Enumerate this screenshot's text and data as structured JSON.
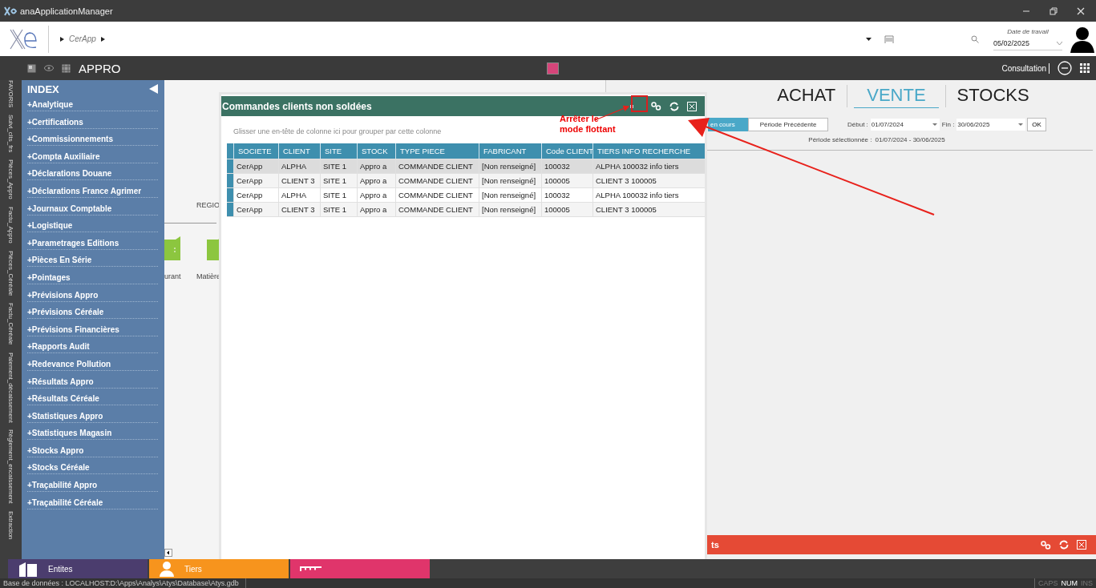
{
  "window": {
    "title": "anaApplicationManager"
  },
  "header": {
    "breadcrumb": [
      "CerApp"
    ],
    "work_date": {
      "label": "Date de travail",
      "value": "05/02/2025"
    }
  },
  "toolbar": {
    "title": "APPRO",
    "mode": "Consultation"
  },
  "side_tabs": [
    "FAVORIS",
    "Suivi_clts_frs",
    "Pièces_Appro",
    "Factu_Appro",
    "Pièces_Céréale",
    "Factu_Céréale",
    "Paiement_décaissement",
    "Règlement_encaissement",
    "Extraction"
  ],
  "index": {
    "title": "INDEX",
    "items": [
      "+Analytique",
      "+Certifications",
      "+Commissionnements",
      "+Compta Auxiliaire",
      "+Déclarations Douane",
      "+Déclarations France Agrimer",
      "+Journaux Comptable",
      "+Logistique",
      "+Parametrages Editions",
      "+Pièces En Série",
      "+Pointages",
      "+Prévisions Appro",
      "+Prévisions Céréale",
      "+Prévisions Financières",
      "+Rapports Audit",
      "+Redevance Pollution",
      "+Résultats Appro",
      "+Résultats Céréale",
      "+Statistiques Appro",
      "+Statistiques Magasin",
      "+Stocks Appro",
      "+Stocks Céréale",
      "+Traçabilité Appro",
      "+Traçabilité Céréale"
    ]
  },
  "background_tiles": {
    "region_label": "REGIO",
    "tile_labels": [
      "urant",
      "Matière"
    ]
  },
  "dashboard": {
    "tabs": [
      {
        "label": "ACHAT",
        "selected": false
      },
      {
        "label": "VENTE",
        "selected": true
      },
      {
        "label": "STOCKS",
        "selected": false
      }
    ],
    "periods": [
      {
        "label": "en cours",
        "selected": true
      },
      {
        "label": "Période Précédente",
        "selected": false
      }
    ],
    "start": {
      "label": "Début :",
      "value": "01/07/2024"
    },
    "end": {
      "label": "Fin :",
      "value": "30/06/2025"
    },
    "ok": "OK",
    "selected_period": {
      "label": "Période sélectionnée :",
      "value": "01/07/2024 - 30/06/2025"
    },
    "panel_title": "ts"
  },
  "floating_window": {
    "title": "Commandes clients non soldées",
    "group_hint": "Glisser une en-tête de colonne ici pour grouper par cette colonne",
    "columns": [
      "SOCIETE",
      "CLIENT",
      "SITE",
      "STOCK",
      "TYPE PIECE",
      "FABRICANT",
      "Code CLIENT",
      "TIERS INFO RECHERCHE"
    ],
    "rows": [
      {
        "selected": true,
        "cells": [
          "CerApp",
          "ALPHA",
          "SITE 1",
          "Appro a",
          "COMMANDE CLIENT",
          "[Non renseigné]",
          "100032",
          "ALPHA 100032 info tiers"
        ]
      },
      {
        "selected": false,
        "cells": [
          "CerApp",
          "CLIENT 3",
          "SITE 1",
          "Appro a",
          "COMMANDE CLIENT",
          "[Non renseigné]",
          "100005",
          "CLIENT 3 100005"
        ]
      },
      {
        "selected": false,
        "cells": [
          "CerApp",
          "ALPHA",
          "SITE 1",
          "Appro a",
          "COMMANDE CLIENT",
          "[Non renseigné]",
          "100032",
          "ALPHA 100032 info tiers"
        ]
      },
      {
        "selected": false,
        "cells": [
          "CerApp",
          "CLIENT 3",
          "SITE 1",
          "Appro a",
          "COMMANDE CLIENT",
          "[Non renseigné]",
          "100005",
          "CLIENT 3 100005"
        ]
      }
    ]
  },
  "annotation": {
    "lines": [
      "Arrêter le",
      "mode flottant"
    ]
  },
  "taskbar": [
    {
      "label": "Entites",
      "color": "#4b3d6e"
    },
    {
      "label": "Tiers",
      "color": "#f7941d"
    },
    {
      "color": "#e0356b"
    }
  ],
  "status_bar": {
    "database": "Base de données : LOCALHOST:D:\\Apps\\Analys\\Atys\\Database\\Atys.gdb",
    "indicators": [
      {
        "label": "CAPS",
        "on": false
      },
      {
        "label": "NUM",
        "on": true
      },
      {
        "label": "INS",
        "on": false
      }
    ]
  }
}
